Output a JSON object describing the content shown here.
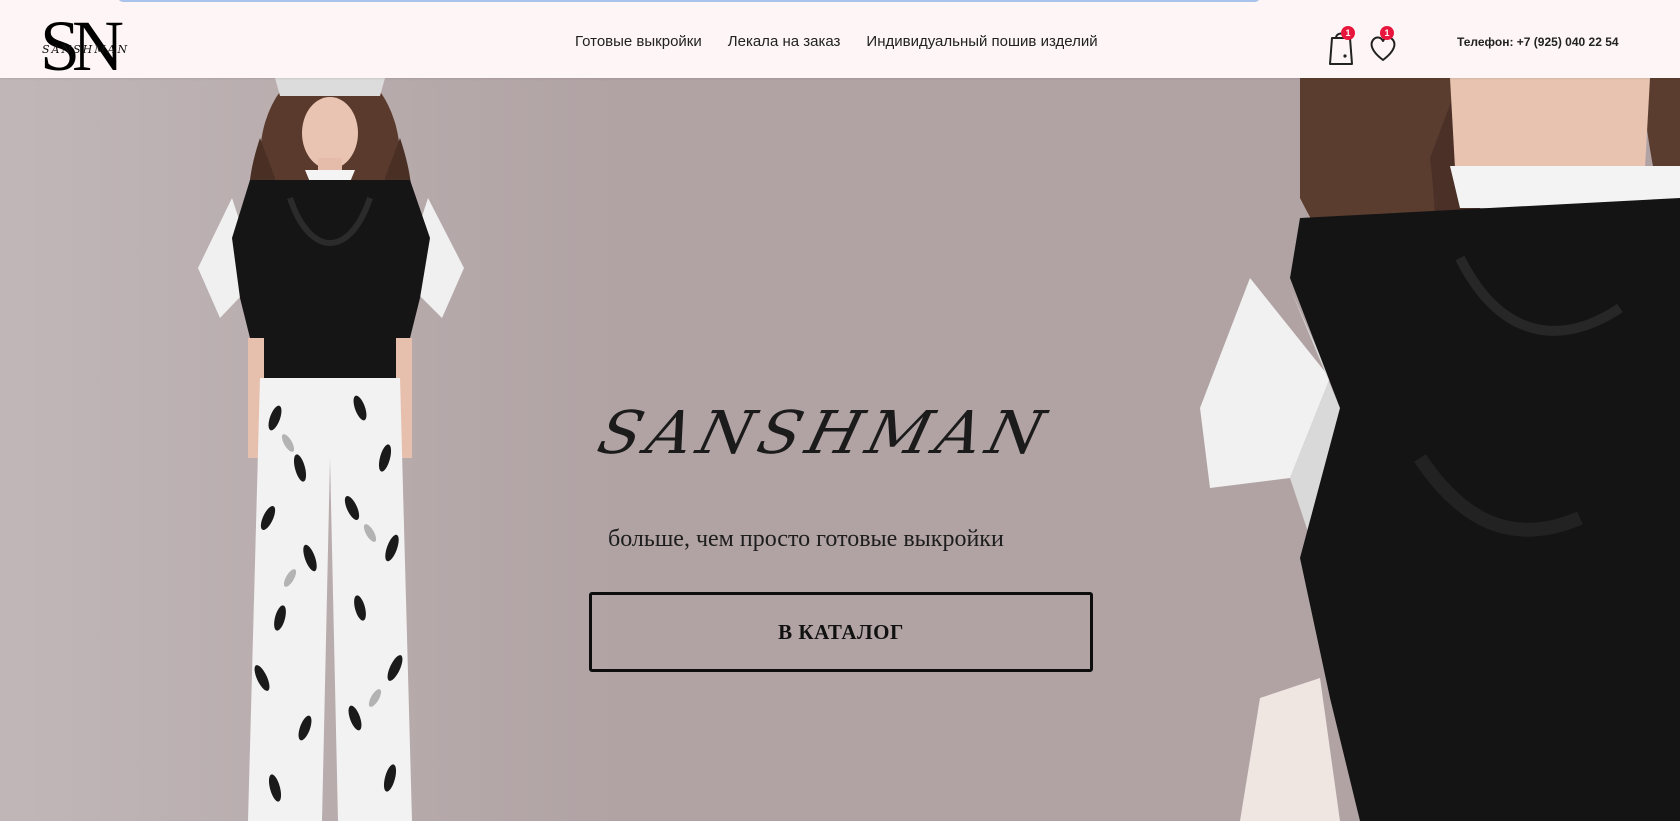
{
  "header": {
    "logo_monogram": "SN",
    "logo_script": "SANSHMAN",
    "nav": [
      {
        "label": "Готовые выкройки"
      },
      {
        "label": "Лекала на заказ"
      },
      {
        "label": "Индивидуальный пошив изделий"
      }
    ],
    "cart_count": "1",
    "favorites_count": "1",
    "phone": "Телефон: +7 (925) 040 22 54"
  },
  "hero": {
    "brand_script": "SANSHMAN",
    "tagline": "больше, чем просто готовые выкройки",
    "cta_label": "В КАТАЛОГ"
  },
  "colors": {
    "header_bg": "#fdf5f6",
    "hero_bg": "#b1a3a4",
    "badge": "#e8163c",
    "text": "#222222"
  },
  "icons": [
    "cart-icon",
    "heart-icon"
  ]
}
